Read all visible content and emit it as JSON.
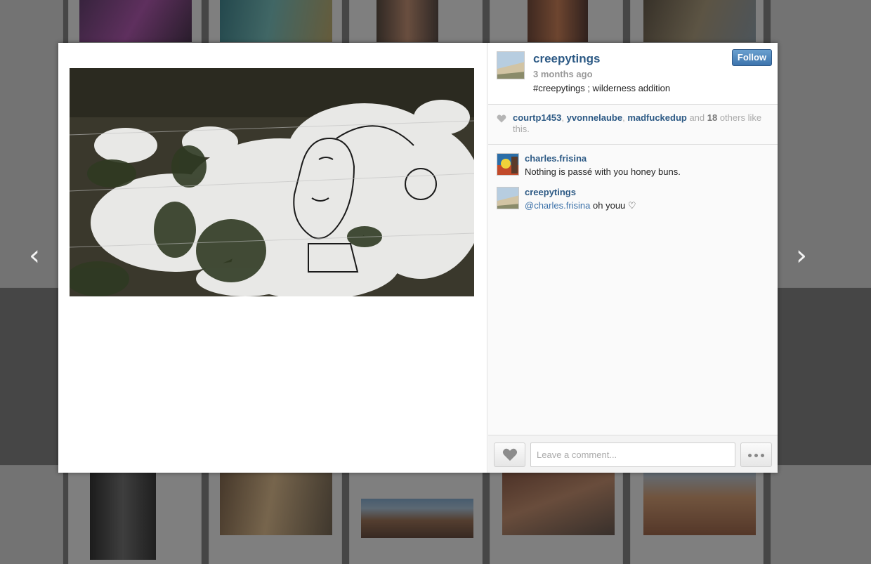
{
  "nav": {
    "prev": "‹",
    "next": "›"
  },
  "post": {
    "owner": "creepytings",
    "time_ago": "3 months ago",
    "caption": "#creepytings ; wilderness addition",
    "follow_label": "Follow"
  },
  "likes": {
    "users": [
      "courtp1453",
      "yvonnelaube",
      "madfuckedup"
    ],
    "sep": ", ",
    "and_word": " and ",
    "others_count": "18",
    "others_suffix": " others like this."
  },
  "comments": [
    {
      "user": "charles.frisina",
      "text": "Nothing is passé with you honey buns."
    },
    {
      "user": "creepytings",
      "mention": "@charles.frisina",
      "text": " oh youu ♡"
    }
  ],
  "comment_box": {
    "placeholder": "Leave a comment..."
  },
  "colors": {
    "link": "#2d5a85",
    "follow_btn": "#3d74ad",
    "background_dim": "#6b6b6b"
  }
}
